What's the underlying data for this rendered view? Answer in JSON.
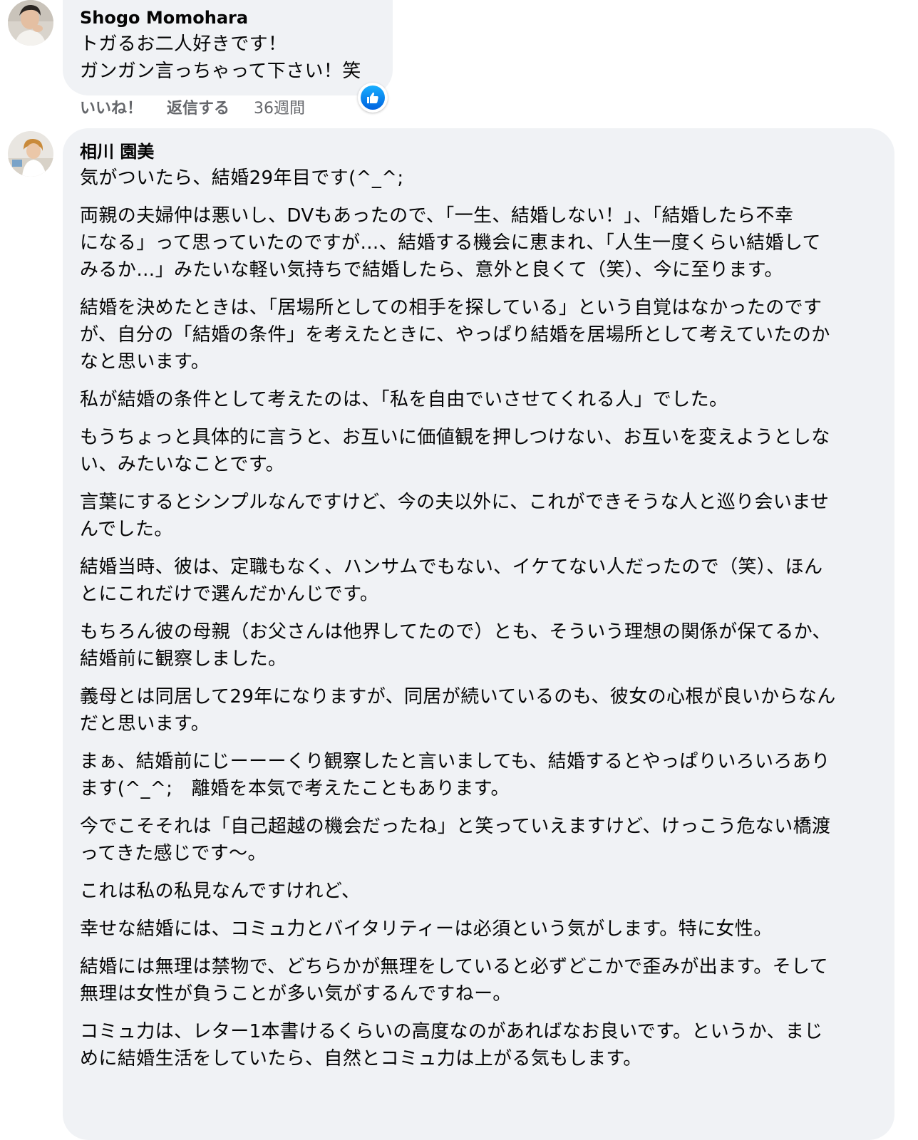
{
  "colors": {
    "bubble_bg": "#f0f2f5",
    "text": "#050505",
    "meta_text": "#65676b",
    "like_blue": "#1877f2"
  },
  "comment1": {
    "author": "Shogo Momohara",
    "avatar_icon": "user-avatar",
    "lines": [
      "トガるお二人好きです！",
      "ガンガン言っちゃって下さい！笑"
    ],
    "reaction_icon": "like-reaction-icon",
    "actions": {
      "like_label": "いいね！",
      "reply_label": "返信する",
      "timestamp": "36週間"
    }
  },
  "comment2": {
    "author": "相川 園美",
    "avatar_icon": "user-avatar",
    "first_line": "気がついたら、結婚29年目です(^_^;",
    "paragraphs": [
      [
        "両親の夫婦仲は悪いし、DVもあったので、「一生、結婚しない！」、「結婚したら不幸",
        "になる」って思っていたのですが…、結婚する機会に恵まれ、「人生一度くらい結婚して",
        "みるか…」みたいな軽い気持ちで結婚したら、意外と良くて（笑）、今に至ります。"
      ],
      [
        "結婚を決めたときは、「居場所としての相手を探している」という自覚はなかったのです",
        "が、自分の「結婚の条件」を考えたときに、やっぱり結婚を居場所として考えていたのか",
        "なと思います。"
      ],
      [
        "私が結婚の条件として考えたのは、「私を自由でいさせてくれる人」でした。"
      ],
      [
        "もうちょっと具体的に言うと、お互いに価値観を押しつけない、お互いを変えようとしな",
        "い、みたいなことです。"
      ],
      [
        "言葉にするとシンプルなんですけど、今の夫以外に、これができそうな人と巡り会いませ",
        "んでした。"
      ],
      [
        "結婚当時、彼は、定職もなく、ハンサムでもない、イケてない人だったので（笑）、ほん",
        "とにこれだけで選んだかんじです。"
      ],
      [
        "もちろん彼の母親（お父さんは他界してたので）とも、そういう理想の関係が保てるか、",
        "結婚前に観察しました。"
      ],
      [
        "義母とは同居して29年になりますが、同居が続いているのも、彼女の心根が良いからなん",
        "だと思います。"
      ],
      [
        "まぁ、結婚前にじーーーくり観察したと言いましても、結婚するとやっぱりいろいろあり",
        "ます(^_^;　離婚を本気で考えたこともあります。"
      ],
      [
        "今でこそそれは「自己超越の機会だったね」と笑っていえますけど、けっこう危ない橋渡",
        "ってきた感じです〜。"
      ],
      [
        "これは私の私見なんですけれど、"
      ],
      [
        "幸せな結婚には、コミュ力とバイタリティーは必須という気がします。特に女性。"
      ],
      [
        "結婚には無理は禁物で、どちらかが無理をしていると必ずどこかで歪みが出ます。そして",
        "無理は女性が負うことが多い気がするんですねー。"
      ],
      [
        "コミュ力は、レター1本書けるくらいの高度なのがあればなお良いです。というか、まじ",
        "めに結婚生活をしていたら、自然とコミュ力は上がる気もします。"
      ]
    ]
  }
}
